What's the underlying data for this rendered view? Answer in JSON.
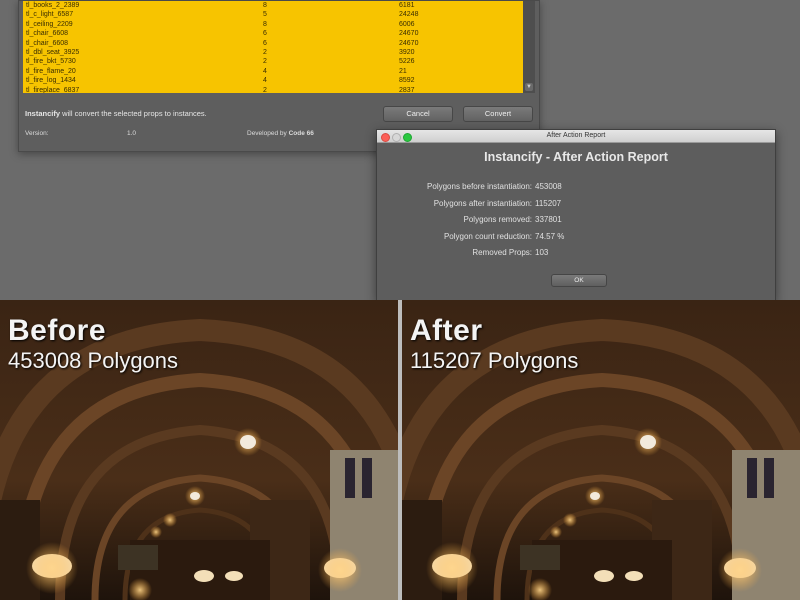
{
  "instancify_dialog": {
    "props": [
      {
        "name": "tl_books_2_2389",
        "count": "8",
        "polygons": "6181"
      },
      {
        "name": "tl_c_light_6587",
        "count": "5",
        "polygons": "24248"
      },
      {
        "name": "tl_ceiling_2209",
        "count": "8",
        "polygons": "6006"
      },
      {
        "name": "tl_chair_6608",
        "count": "6",
        "polygons": "24670"
      },
      {
        "name": "tl_chair_6608",
        "count": "6",
        "polygons": "24670"
      },
      {
        "name": "tl_dbl_seat_3925",
        "count": "2",
        "polygons": "3920"
      },
      {
        "name": "tl_fire_bkt_5730",
        "count": "2",
        "polygons": "5226"
      },
      {
        "name": "tl_fire_flame_20",
        "count": "4",
        "polygons": "21"
      },
      {
        "name": "tl_fire_log_1434",
        "count": "4",
        "polygons": "8592"
      },
      {
        "name": "tl_fireplace_6837",
        "count": "2",
        "polygons": "2837"
      }
    ],
    "message_brand": "Instancify",
    "message_rest": " will convert the selected props to instances.",
    "cancel_label": "Cancel",
    "convert_label": "Convert",
    "version_label": "Version:",
    "version_value": "1.0",
    "developed_prefix": "Developed by ",
    "developer": "Code 66"
  },
  "report_window": {
    "window_title": "After Action Report",
    "heading": "Instancify - After Action Report",
    "stats": [
      {
        "label": "Polygons before instantiation:",
        "value": "453008"
      },
      {
        "label": "Polygons after instantiation:",
        "value": "115207"
      },
      {
        "label": "Polygons removed:",
        "value": "337801"
      },
      {
        "label": "Polygon count reduction:",
        "value": "74.57 %"
      },
      {
        "label": "Removed Props:",
        "value": "103"
      }
    ],
    "ok_label": "OK"
  },
  "panels": {
    "before": {
      "title": "Before",
      "subtitle": "453008 Polygons"
    },
    "after": {
      "title": "After",
      "subtitle": "115207 Polygons"
    }
  },
  "colors": {
    "list_highlight": "#f7c400",
    "close_button": "#fc5f57",
    "zoom_button": "#2ac840"
  }
}
